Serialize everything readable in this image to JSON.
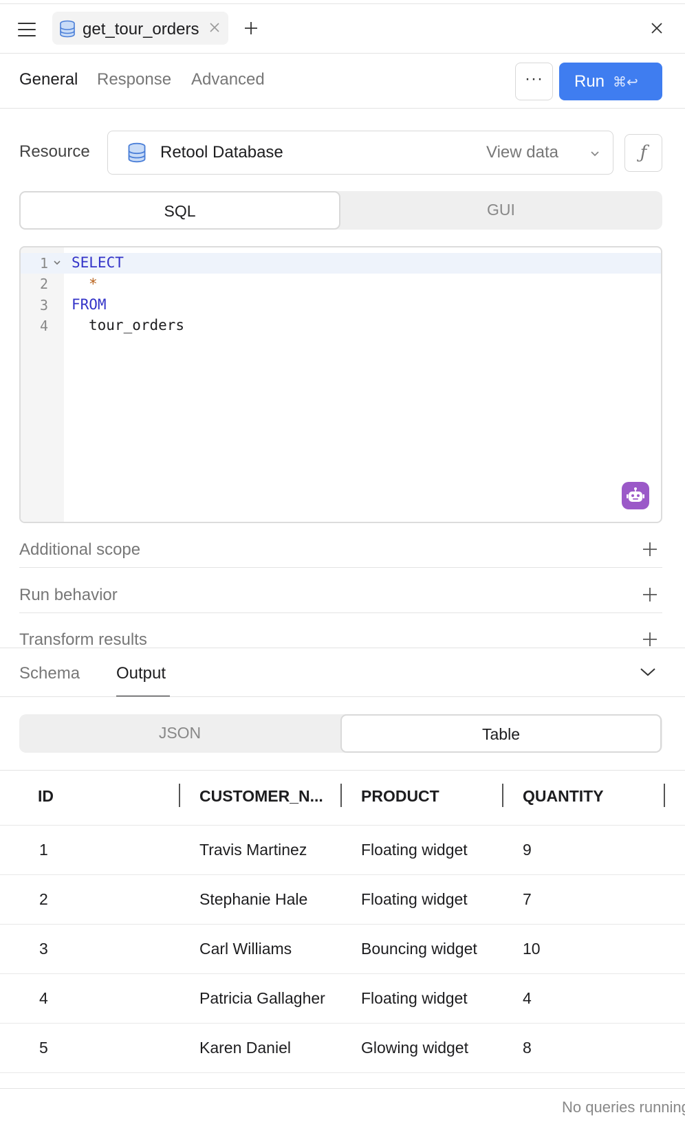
{
  "header": {
    "query_name": "get_tour_orders"
  },
  "tabs": {
    "general": "General",
    "response": "Response",
    "advanced": "Advanced"
  },
  "actions": {
    "more_label": "···",
    "run_label": "Run",
    "run_shortcut": "⌘↩",
    "run_color": "#3f7df0"
  },
  "resource": {
    "label": "Resource",
    "selected": "Retool Database",
    "view_data": "View data",
    "fx_label": "ƒ"
  },
  "mode": {
    "sql": "SQL",
    "gui": "GUI",
    "selected": "SQL"
  },
  "editor": {
    "line_numbers": [
      "1",
      "2",
      "3",
      "4"
    ],
    "lines": [
      "SELECT",
      "*",
      "FROM",
      "tour_orders"
    ]
  },
  "sections": {
    "additional_scope": "Additional scope",
    "run_behavior": "Run behavior",
    "transform_results": "Transform results"
  },
  "output": {
    "tabs": {
      "schema": "Schema",
      "output": "Output"
    },
    "active_tab": "Output",
    "format": {
      "json": "JSON",
      "table": "Table",
      "selected": "Table"
    }
  },
  "table": {
    "columns": [
      "ID",
      "CUSTOMER_N...",
      "PRODUCT",
      "QUANTITY"
    ],
    "rows": [
      [
        "1",
        "Travis Martinez",
        "Floating widget",
        "9"
      ],
      [
        "2",
        "Stephanie Hale",
        "Floating widget",
        "7"
      ],
      [
        "3",
        "Carl Williams",
        "Bouncing widget",
        "10"
      ],
      [
        "4",
        "Patricia Gallagher",
        "Floating widget",
        "4"
      ],
      [
        "5",
        "Karen Daniel",
        "Glowing widget",
        "8"
      ]
    ]
  },
  "status": "No queries running"
}
